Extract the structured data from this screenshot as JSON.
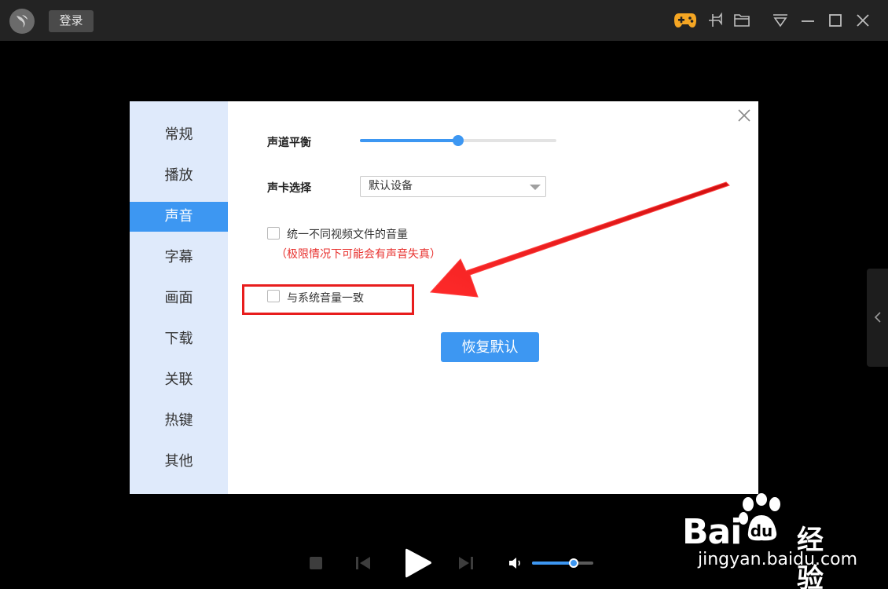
{
  "titlebar": {
    "login_label": "登录"
  },
  "nav": {
    "items": [
      "常规",
      "播放",
      "声音",
      "字幕",
      "画面",
      "下载",
      "关联",
      "热键",
      "其他"
    ],
    "active": "声音"
  },
  "sound": {
    "balance_label": "声道平衡",
    "balance_value": 0.5,
    "device_label": "声卡选择",
    "device_value": "默认设备",
    "unify_volume_label": "统一不同视频文件的音量",
    "unify_volume_warning": "（极限情况下可能会有声音失真）",
    "unify_volume_checked": false,
    "sync_system_label": "与系统音量一致",
    "sync_system_checked": false,
    "restore_label": "恢复默认"
  },
  "player": {
    "volume": 0.68
  },
  "watermark": {
    "brand": "Bai",
    "brand_suffix": "经验",
    "url": "jingyan.baidu.com"
  },
  "colors": {
    "accent": "#3d97f2",
    "highlight": "#e81d1d",
    "nav_bg": "#dfeafb",
    "titlebar": "#232323"
  }
}
